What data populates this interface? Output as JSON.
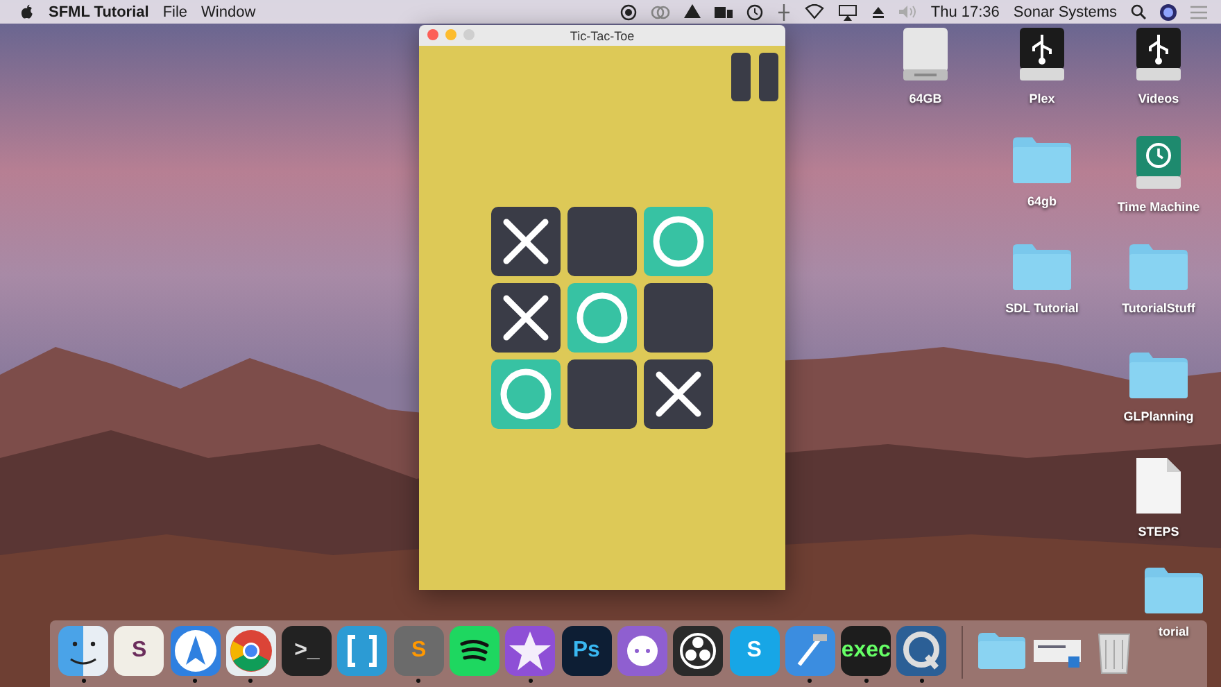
{
  "menu_bar": {
    "app_name": "SFML Tutorial",
    "menus": [
      "File",
      "Window"
    ],
    "clock": "Thu 17:36",
    "user": "Sonar Systems"
  },
  "window": {
    "title": "Tic-Tac-Toe",
    "board": [
      {
        "kind": "x"
      },
      {
        "kind": "empty"
      },
      {
        "kind": "o"
      },
      {
        "kind": "x"
      },
      {
        "kind": "o"
      },
      {
        "kind": "empty"
      },
      {
        "kind": "o"
      },
      {
        "kind": "empty"
      },
      {
        "kind": "x"
      }
    ]
  },
  "desktop_icons": [
    {
      "label": "64GB",
      "kind": "drive"
    },
    {
      "label": "Plex",
      "kind": "usb"
    },
    {
      "label": "Videos",
      "kind": "usb"
    },
    {
      "label": "64gb",
      "kind": "folder"
    },
    {
      "label": "Time Machine",
      "kind": "timemachine"
    },
    {
      "label": "SDL Tutorial",
      "kind": "folder"
    },
    {
      "label": "TutorialStuff",
      "kind": "folder"
    },
    {
      "label": "GLPlanning",
      "kind": "folder"
    },
    {
      "label": "STEPS",
      "kind": "document"
    },
    {
      "label": "torial",
      "kind": "folder"
    }
  ],
  "dock": [
    {
      "kind": "finder",
      "running": true
    },
    {
      "kind": "slack",
      "glyph": "S",
      "running": false
    },
    {
      "kind": "spark",
      "running": true
    },
    {
      "kind": "chrome",
      "running": true
    },
    {
      "kind": "terminal",
      "glyph": ">_",
      "running": false
    },
    {
      "kind": "brackets",
      "running": false
    },
    {
      "kind": "sublime",
      "glyph": "S",
      "running": true
    },
    {
      "kind": "spotify",
      "running": false
    },
    {
      "kind": "imovie",
      "running": true
    },
    {
      "kind": "photoshop",
      "glyph": "Ps",
      "running": false
    },
    {
      "kind": "github",
      "running": false
    },
    {
      "kind": "obs",
      "running": false
    },
    {
      "kind": "skype",
      "glyph": "S",
      "running": false
    },
    {
      "kind": "xcode",
      "running": true
    },
    {
      "kind": "exec",
      "glyph": "exec",
      "running": true
    },
    {
      "kind": "quicktime",
      "running": true
    },
    {
      "kind": "separator"
    },
    {
      "kind": "folder",
      "running": false
    },
    {
      "kind": "screen",
      "running": false
    },
    {
      "kind": "trash",
      "running": false
    }
  ]
}
